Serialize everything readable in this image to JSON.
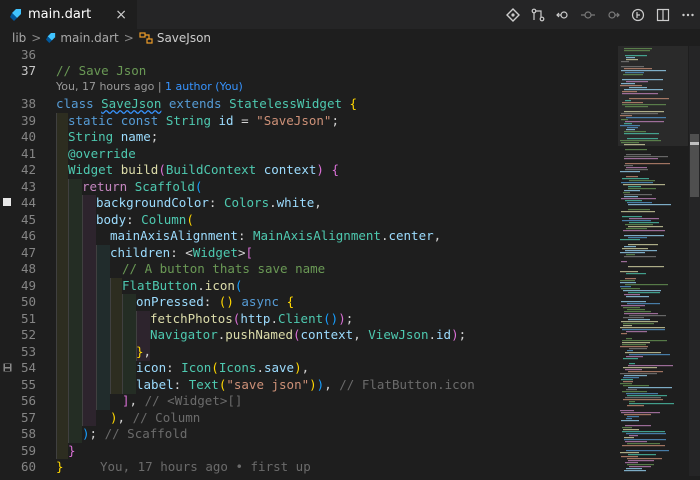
{
  "tab": {
    "file_name": "main.dart",
    "close": "×"
  },
  "actions": [
    "git-compare-icon",
    "source-control-icon",
    "go-back-icon",
    "timeline-icon",
    "go-forward-icon",
    "git-lens-icon",
    "split-editor-icon",
    "more-actions-icon"
  ],
  "breadcrumb": {
    "folder": "lib",
    "file": "main.dart",
    "symbol": "SaveJson",
    "separator": ">"
  },
  "codelens": {
    "author_text": "You, 17 hours ago | ",
    "authors_link": "1 author (You)"
  },
  "blame_inline": "You, 17 hours ago • first up",
  "lines": [
    {
      "n": "36",
      "tokens": []
    },
    {
      "n": "37",
      "tokens": [
        {
          "t": "// Save Json",
          "c": "com"
        }
      ]
    },
    {
      "n": "38",
      "tokens": [
        {
          "t": "class ",
          "c": "kw"
        },
        {
          "t": "SaveJson",
          "c": "ty"
        },
        {
          "t": " extends ",
          "c": "kw"
        },
        {
          "t": "StatelessWidget",
          "c": "ty"
        },
        {
          "t": " ",
          "c": "pl"
        },
        {
          "t": "{",
          "c": "brk1"
        }
      ]
    },
    {
      "n": "39",
      "tokens": [
        {
          "t": "static ",
          "c": "kw"
        },
        {
          "t": "const ",
          "c": "kw"
        },
        {
          "t": "String ",
          "c": "ty"
        },
        {
          "t": "id",
          "c": "var"
        },
        {
          "t": " = ",
          "c": "pl"
        },
        {
          "t": "\"SaveJson\"",
          "c": "str"
        },
        {
          "t": ";",
          "c": "pl"
        }
      ]
    },
    {
      "n": "40",
      "tokens": [
        {
          "t": "String ",
          "c": "ty"
        },
        {
          "t": "name",
          "c": "var"
        },
        {
          "t": ";",
          "c": "pl"
        }
      ]
    },
    {
      "n": "41",
      "tokens": [
        {
          "t": "@override",
          "c": "ty"
        }
      ]
    },
    {
      "n": "42",
      "tokens": [
        {
          "t": "Widget ",
          "c": "ty"
        },
        {
          "t": "build",
          "c": "fn"
        },
        {
          "t": "(",
          "c": "brk2"
        },
        {
          "t": "BuildContext ",
          "c": "ty"
        },
        {
          "t": "context",
          "c": "var"
        },
        {
          "t": ")",
          "c": "brk2"
        },
        {
          "t": " ",
          "c": "pl"
        },
        {
          "t": "{",
          "c": "brk2"
        }
      ]
    },
    {
      "n": "43",
      "tokens": [
        {
          "t": "return ",
          "c": "ctl"
        },
        {
          "t": "Scaffold",
          "c": "ty"
        },
        {
          "t": "(",
          "c": "brk3"
        }
      ]
    },
    {
      "n": "44",
      "tokens": [
        {
          "t": "backgroundColor",
          "c": "var"
        },
        {
          "t": ": ",
          "c": "pl"
        },
        {
          "t": "Colors",
          "c": "ty"
        },
        {
          "t": ".",
          "c": "pl"
        },
        {
          "t": "white",
          "c": "var"
        },
        {
          "t": ",",
          "c": "pl"
        }
      ]
    },
    {
      "n": "45",
      "tokens": [
        {
          "t": "body",
          "c": "var"
        },
        {
          "t": ": ",
          "c": "pl"
        },
        {
          "t": "Column",
          "c": "ty"
        },
        {
          "t": "(",
          "c": "brk1"
        }
      ]
    },
    {
      "n": "46",
      "tokens": [
        {
          "t": "mainAxisAlignment",
          "c": "var"
        },
        {
          "t": ": ",
          "c": "pl"
        },
        {
          "t": "MainAxisAlignment",
          "c": "ty"
        },
        {
          "t": ".",
          "c": "pl"
        },
        {
          "t": "center",
          "c": "var"
        },
        {
          "t": ",",
          "c": "pl"
        }
      ]
    },
    {
      "n": "47",
      "tokens": [
        {
          "t": "children",
          "c": "var"
        },
        {
          "t": ": <",
          "c": "pl"
        },
        {
          "t": "Widget",
          "c": "ty"
        },
        {
          "t": ">",
          "c": "pl"
        },
        {
          "t": "[",
          "c": "brk2"
        }
      ]
    },
    {
      "n": "48",
      "tokens": [
        {
          "t": "// A button thats save name",
          "c": "com"
        }
      ]
    },
    {
      "n": "49",
      "tokens": [
        {
          "t": "FlatButton",
          "c": "ty"
        },
        {
          "t": ".",
          "c": "pl"
        },
        {
          "t": "icon",
          "c": "fn"
        },
        {
          "t": "(",
          "c": "brk3"
        }
      ]
    },
    {
      "n": "50",
      "tokens": [
        {
          "t": "onPressed",
          "c": "var"
        },
        {
          "t": ": ",
          "c": "pl"
        },
        {
          "t": "()",
          "c": "brk1"
        },
        {
          "t": " ",
          "c": "pl"
        },
        {
          "t": "async",
          "c": "kw"
        },
        {
          "t": " ",
          "c": "pl"
        },
        {
          "t": "{",
          "c": "brk1"
        }
      ]
    },
    {
      "n": "51",
      "tokens": [
        {
          "t": "fetchPhotos",
          "c": "fn"
        },
        {
          "t": "(",
          "c": "brk2"
        },
        {
          "t": "http",
          "c": "var"
        },
        {
          "t": ".",
          "c": "pl"
        },
        {
          "t": "Client",
          "c": "ty"
        },
        {
          "t": "()",
          "c": "brk3"
        },
        {
          "t": ")",
          "c": "brk2"
        },
        {
          "t": ";",
          "c": "pl"
        }
      ]
    },
    {
      "n": "52",
      "tokens": [
        {
          "t": "Navigator",
          "c": "ty"
        },
        {
          "t": ".",
          "c": "pl"
        },
        {
          "t": "pushNamed",
          "c": "fn"
        },
        {
          "t": "(",
          "c": "brk2"
        },
        {
          "t": "context",
          "c": "var"
        },
        {
          "t": ", ",
          "c": "pl"
        },
        {
          "t": "ViewJson",
          "c": "ty"
        },
        {
          "t": ".",
          "c": "pl"
        },
        {
          "t": "id",
          "c": "var"
        },
        {
          "t": ")",
          "c": "brk2"
        },
        {
          "t": ";",
          "c": "pl"
        }
      ]
    },
    {
      "n": "53",
      "tokens": [
        {
          "t": "}",
          "c": "brk1"
        },
        {
          "t": ",",
          "c": "pl"
        }
      ]
    },
    {
      "n": "54",
      "tokens": [
        {
          "t": "icon",
          "c": "var"
        },
        {
          "t": ": ",
          "c": "pl"
        },
        {
          "t": "Icon",
          "c": "ty"
        },
        {
          "t": "(",
          "c": "brk1"
        },
        {
          "t": "Icons",
          "c": "ty"
        },
        {
          "t": ".",
          "c": "pl"
        },
        {
          "t": "save",
          "c": "var"
        },
        {
          "t": ")",
          "c": "brk1"
        },
        {
          "t": ",",
          "c": "pl"
        }
      ]
    },
    {
      "n": "55",
      "tokens": [
        {
          "t": "label",
          "c": "var"
        },
        {
          "t": ": ",
          "c": "pl"
        },
        {
          "t": "Text",
          "c": "ty"
        },
        {
          "t": "(",
          "c": "brk1"
        },
        {
          "t": "\"save json\"",
          "c": "str"
        },
        {
          "t": ")",
          "c": "brk1"
        },
        {
          "t": ")",
          "c": "brk3"
        },
        {
          "t": ", ",
          "c": "pl"
        },
        {
          "t": "// FlatButton.icon",
          "c": "ghost"
        }
      ]
    },
    {
      "n": "56",
      "tokens": [
        {
          "t": "]",
          "c": "brk2"
        },
        {
          "t": ", ",
          "c": "pl"
        },
        {
          "t": "// <Widget>[]",
          "c": "ghost"
        }
      ]
    },
    {
      "n": "57",
      "tokens": [
        {
          "t": ")",
          "c": "brk1"
        },
        {
          "t": ", ",
          "c": "pl"
        },
        {
          "t": "// Column",
          "c": "ghost"
        }
      ]
    },
    {
      "n": "58",
      "tokens": [
        {
          "t": ")",
          "c": "brk3"
        },
        {
          "t": "; ",
          "c": "pl"
        },
        {
          "t": "// Scaffold",
          "c": "ghost"
        }
      ]
    },
    {
      "n": "59",
      "tokens": [
        {
          "t": "}",
          "c": "brk2"
        }
      ]
    },
    {
      "n": "60",
      "tokens": [
        {
          "t": "}",
          "c": "brk1"
        }
      ]
    }
  ],
  "colors": {
    "editor_bg": "#1e1e1e",
    "tab_bar_bg": "#252526",
    "gutter_text": "#858585",
    "link": "#3794ff"
  }
}
